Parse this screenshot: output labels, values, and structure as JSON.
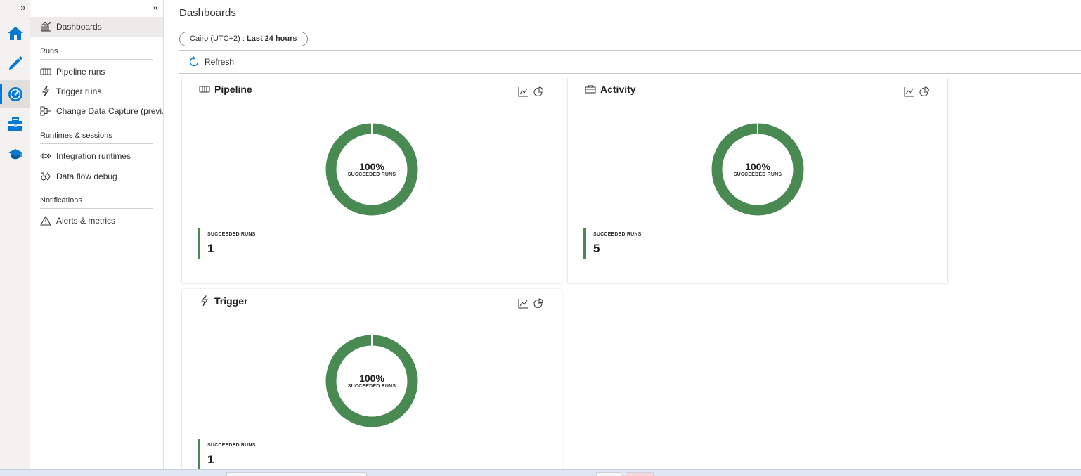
{
  "rail": {
    "expand_glyph": "»",
    "items": [
      {
        "name": "home",
        "icon": "home-icon"
      },
      {
        "name": "author",
        "icon": "pencil-icon"
      },
      {
        "name": "monitor",
        "icon": "monitor-gauge-icon",
        "active": true
      },
      {
        "name": "manage",
        "icon": "toolbox-icon"
      },
      {
        "name": "learning",
        "icon": "graduation-cap-icon"
      }
    ]
  },
  "nav": {
    "collapse_glyph": "«",
    "dashboards_label": "Dashboards",
    "sections": {
      "runs": "Runs",
      "runtimes": "Runtimes & sessions",
      "notifications": "Notifications"
    },
    "items": {
      "pipeline_runs": "Pipeline runs",
      "trigger_runs": "Trigger runs",
      "cdc": "Change Data Capture (previ...",
      "integration_runtimes": "Integration runtimes",
      "data_flow_debug": "Data flow debug",
      "alerts_metrics": "Alerts & metrics"
    }
  },
  "header": {
    "title": "Dashboards",
    "timezone": "Cairo (UTC+2) : ",
    "range": "Last 24 hours",
    "refresh_label": "Refresh"
  },
  "cards": {
    "pipeline": {
      "title": "Pipeline",
      "percent": "100%",
      "donut_label": "SUCCEEDED RUNS",
      "stat_label": "SUCCEEDED RUNS",
      "stat_value": "1"
    },
    "activity": {
      "title": "Activity",
      "percent": "100%",
      "donut_label": "SUCCEEDED RUNS",
      "stat_label": "SUCCEEDED RUNS",
      "stat_value": "5"
    },
    "trigger": {
      "title": "Trigger",
      "percent": "100%",
      "donut_label": "SUCCEEDED RUNS",
      "stat_label": "SUCCEEDED RUNS",
      "stat_value": "1"
    }
  },
  "colors": {
    "success": "#498a52",
    "accent": "#0078d4"
  }
}
